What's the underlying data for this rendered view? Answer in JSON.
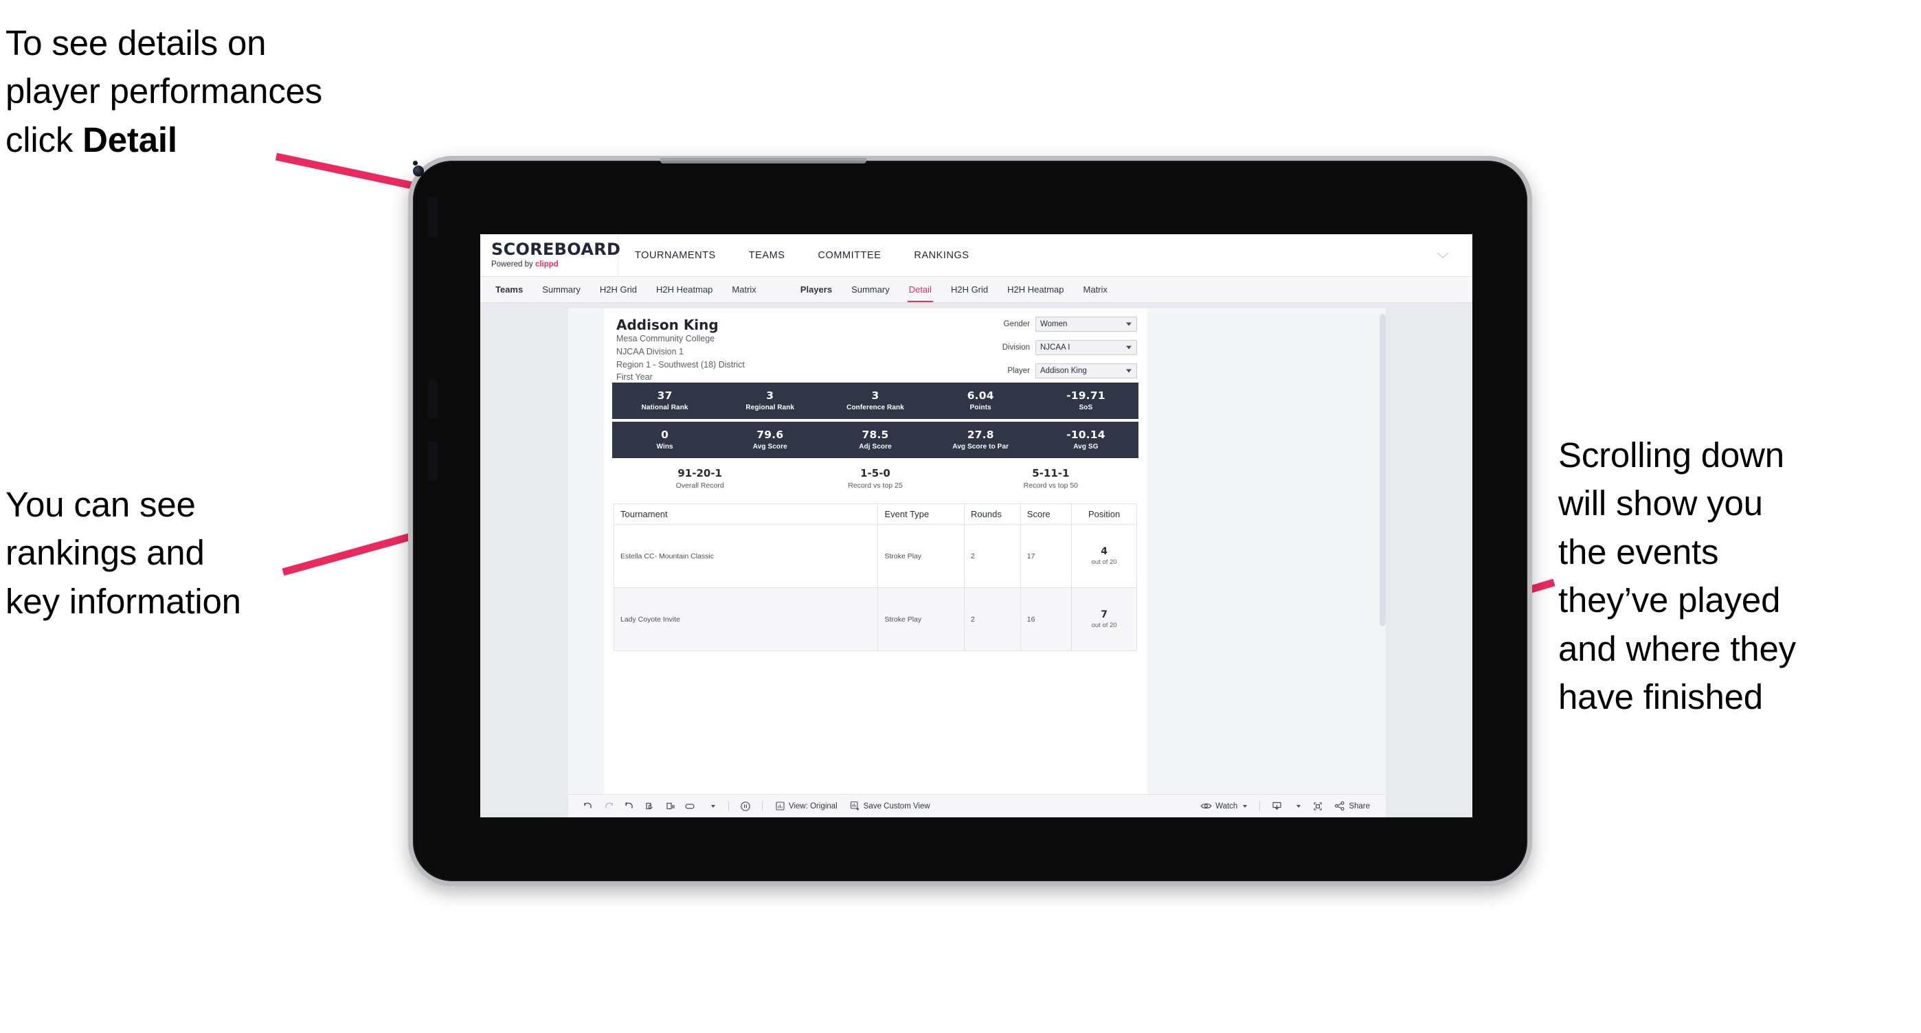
{
  "annotations": {
    "top_left": {
      "line1": "To see details on",
      "line2": "player performances",
      "line3_prefix": "click ",
      "line3_bold": "Detail"
    },
    "mid_left": "You can see\nrankings and\nkey information",
    "right": "Scrolling down\nwill show you\nthe events\nthey’ve played\nand where they\nhave finished",
    "arrow_color": "#ea2a5e"
  },
  "header": {
    "brand_title": "SCOREBOARD",
    "brand_sub_prefix": "Powered by ",
    "brand_sub_accent": "clippd",
    "nav": [
      {
        "label": "TOURNAMENTS"
      },
      {
        "label": "TEAMS"
      },
      {
        "label": "COMMITTEE"
      },
      {
        "label": "RANKINGS"
      }
    ]
  },
  "sub_nav": {
    "teams_group": [
      {
        "label": "Teams",
        "head": true,
        "active": false
      },
      {
        "label": "Summary",
        "head": false,
        "active": false
      },
      {
        "label": "H2H Grid",
        "head": false,
        "active": false
      },
      {
        "label": "H2H Heatmap",
        "head": false,
        "active": false
      },
      {
        "label": "Matrix",
        "head": false,
        "active": false
      }
    ],
    "players_group": [
      {
        "label": "Players",
        "head": true,
        "active": false
      },
      {
        "label": "Summary",
        "head": false,
        "active": false
      },
      {
        "label": "Detail",
        "head": false,
        "active": true
      },
      {
        "label": "H2H Grid",
        "head": false,
        "active": false
      },
      {
        "label": "H2H Heatmap",
        "head": false,
        "active": false
      },
      {
        "label": "Matrix",
        "head": false,
        "active": false
      }
    ]
  },
  "player": {
    "name": "Addison King",
    "school": "Mesa Community College",
    "division": "NJCAA Division 1",
    "region": "Region 1 - Southwest (18) District",
    "year": "First Year"
  },
  "filters": [
    {
      "label": "Gender",
      "value": "Women"
    },
    {
      "label": "Division",
      "value": "NJCAA I"
    },
    {
      "label": "Player",
      "value": "Addison King"
    }
  ],
  "stats_band_1": [
    {
      "value": "37",
      "label": "National Rank"
    },
    {
      "value": "3",
      "label": "Regional Rank"
    },
    {
      "value": "3",
      "label": "Conference Rank"
    },
    {
      "value": "6.04",
      "label": "Points"
    },
    {
      "value": "-19.71",
      "label": "SoS"
    }
  ],
  "stats_band_2": [
    {
      "value": "0",
      "label": "Wins"
    },
    {
      "value": "79.6",
      "label": "Avg Score"
    },
    {
      "value": "78.5",
      "label": "Adj Score"
    },
    {
      "value": "27.8",
      "label": "Avg Score to Par"
    },
    {
      "value": "-10.14",
      "label": "Avg SG"
    }
  ],
  "records": [
    {
      "value": "91-20-1",
      "label": "Overall Record"
    },
    {
      "value": "1-5-0",
      "label": "Record vs top 25"
    },
    {
      "value": "5-11-1",
      "label": "Record vs top 50"
    }
  ],
  "events_table": {
    "columns": [
      "Tournament",
      "Event Type",
      "Rounds",
      "Score",
      "Position"
    ],
    "rows": [
      {
        "tournament": "Estella CC- Mountain Classic",
        "event_type": "Stroke Play",
        "rounds": "2",
        "score": "17",
        "position_num": "4",
        "position_sub": "out of 20"
      },
      {
        "tournament": "Lady Coyote Invite",
        "event_type": "Stroke Play",
        "rounds": "2",
        "score": "16",
        "position_num": "7",
        "position_sub": "out of 20"
      }
    ]
  },
  "toolbar": {
    "view_label": "View: Original",
    "save_label": "Save Custom View",
    "watch_label": "Watch",
    "share_label": "Share"
  },
  "colors": {
    "accent_pink": "#ed2a5f",
    "band_navy": "#303548",
    "screen_bg": "#e9eaee"
  }
}
